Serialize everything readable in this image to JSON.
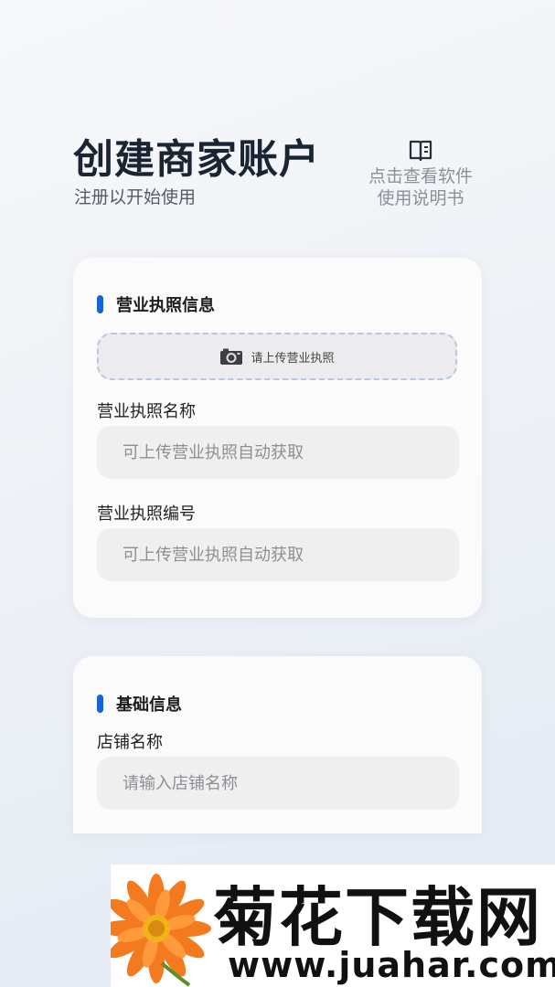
{
  "header": {
    "title": "创建商家账户",
    "subtitle": "注册以开始使用",
    "manual_line1": "点击查看软件",
    "manual_line2": "使用说明书"
  },
  "license_section": {
    "title": "营业执照信息",
    "upload_label": "请上传营业执照",
    "name_label": "营业执照名称",
    "name_placeholder": "可上传营业执照自动获取",
    "number_label": "营业执照编号",
    "number_placeholder": "可上传营业执照自动获取"
  },
  "basic_section": {
    "title": "基础信息",
    "store_label": "店铺名称",
    "store_placeholder": "请输入店铺名称"
  },
  "watermark": {
    "title": "菊花下载网",
    "url": "www.juahar.com"
  },
  "colors": {
    "accent": "#1565d8",
    "title": "#1a2433",
    "input_bg": "#efeff0"
  }
}
